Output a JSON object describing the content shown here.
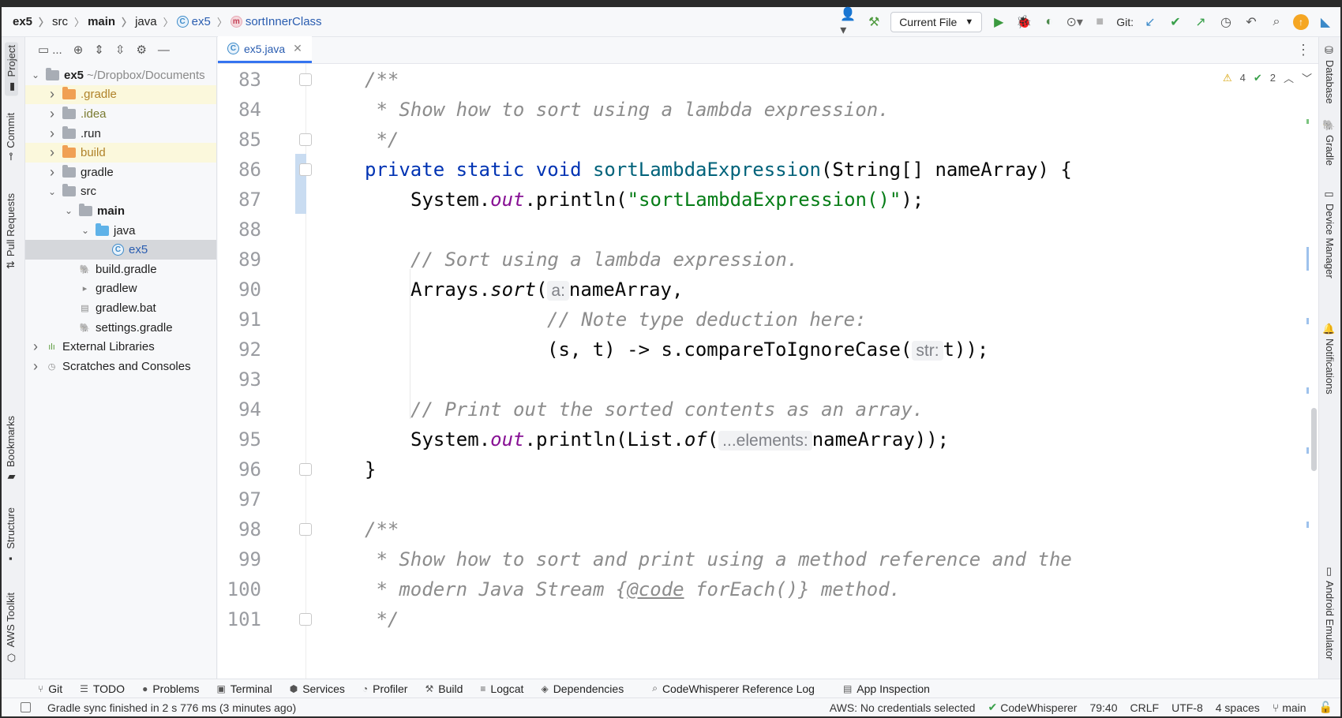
{
  "breadcrumbs": [
    {
      "label": "ex5",
      "bold": true
    },
    {
      "label": "src",
      "bold": false
    },
    {
      "label": "main",
      "bold": true
    },
    {
      "label": "java",
      "bold": false
    },
    {
      "label": "ex5",
      "bold": false,
      "icon": "class-icon"
    },
    {
      "label": "sortInnerClass",
      "bold": false,
      "icon": "method-icon"
    }
  ],
  "toolbar": {
    "run_config": "Current File",
    "git_label": "Git:"
  },
  "left_tabs": [
    "Project",
    "Commit",
    "Pull Requests",
    "Bookmarks",
    "Structure",
    "AWS Toolkit"
  ],
  "right_tabs": [
    "Database",
    "Gradle",
    "Device Manager",
    "Notifications",
    "Android Emulator"
  ],
  "project": {
    "toolbar_label": "...",
    "tree": [
      {
        "label": "ex5",
        "suffix": "~/Dropbox/Documents",
        "level": 0,
        "chevron": "down",
        "kind": "module",
        "bold": true
      },
      {
        "label": ".gradle",
        "level": 1,
        "chevron": "right",
        "kind": "folder-orange",
        "hl": true
      },
      {
        "label": ".idea",
        "level": 1,
        "chevron": "right",
        "kind": "folder-gray"
      },
      {
        "label": ".run",
        "level": 1,
        "chevron": "right",
        "kind": "folder-gray"
      },
      {
        "label": "build",
        "level": 1,
        "chevron": "right",
        "kind": "folder-orange",
        "hl": true
      },
      {
        "label": "gradle",
        "level": 1,
        "chevron": "right",
        "kind": "folder-gray"
      },
      {
        "label": "src",
        "level": 1,
        "chevron": "down",
        "kind": "folder-gray"
      },
      {
        "label": "main",
        "level": 2,
        "chevron": "down",
        "kind": "folder-gray",
        "bold": true
      },
      {
        "label": "java",
        "level": 3,
        "chevron": "down",
        "kind": "folder-blue"
      },
      {
        "label": "ex5",
        "level": 4,
        "chevron": "",
        "kind": "class",
        "sel": true
      },
      {
        "label": "build.gradle",
        "level": 2,
        "chevron": "",
        "kind": "gradle"
      },
      {
        "label": "gradlew",
        "level": 2,
        "chevron": "",
        "kind": "script"
      },
      {
        "label": "gradlew.bat",
        "level": 2,
        "chevron": "",
        "kind": "doc"
      },
      {
        "label": "settings.gradle",
        "level": 2,
        "chevron": "",
        "kind": "gradle"
      },
      {
        "label": "External Libraries",
        "level": 0,
        "chevron": "right",
        "kind": "libs"
      },
      {
        "label": "Scratches and Consoles",
        "level": 0,
        "chevron": "right",
        "kind": "scratch"
      }
    ]
  },
  "editor": {
    "tab_label": "ex5.java",
    "inspections": {
      "warnings": "4",
      "typos": "2"
    },
    "line_numbers": [
      "83",
      "84",
      "85",
      "86",
      "87",
      "88",
      "89",
      "90",
      "91",
      "92",
      "93",
      "94",
      "95",
      "96",
      "97",
      "98",
      "99",
      "100",
      "101"
    ],
    "code": {
      "l83": "/**",
      "l84": " * Show how to sort using a lambda expression.",
      "l85": " */",
      "l86_kw": "private static void ",
      "l86_fn": "sortLambdaExpression",
      "l86_rest": "(String[] nameArray) {",
      "l87_a": "System.",
      "l87_out": "out",
      "l87_b": ".println(",
      "l87_str": "\"sortLambdaExpression()\"",
      "l87_c": ");",
      "l89": "// Sort using a lambda expression.",
      "l90_a": "Arrays.",
      "l90_sort": "sort",
      "l90_b": "(",
      "l90_hint": "a:",
      "l90_c": "nameArray,",
      "l91": "// Note type deduction here:",
      "l92_a": "(s, t) -> s.compareToIgnoreCase(",
      "l92_hint": "str:",
      "l92_b": "t));",
      "l94": "// Print out the sorted contents as an array.",
      "l95_a": "System.",
      "l95_out": "out",
      "l95_b": ".println(List.",
      "l95_of": "of",
      "l95_c": "(",
      "l95_hint": "...elements:",
      "l95_d": "nameArray));",
      "l96": "}",
      "l98": "/**",
      "l99": " * Show how to sort and print using a method reference and the",
      "l100_a": " * modern Java Stream {",
      "l100_tag": "@code",
      "l100_b": " forEach()} method.",
      "l101": " */"
    }
  },
  "bottom_tools": [
    "Git",
    "TODO",
    "Problems",
    "Terminal",
    "Services",
    "Profiler",
    "Build",
    "Logcat",
    "Dependencies",
    "CodeWhisperer Reference Log",
    "App Inspection"
  ],
  "status": {
    "message": "Gradle sync finished in 2 s 776 ms (3 minutes ago)",
    "aws": "AWS: No credentials selected",
    "codewhisperer": "CodeWhisperer",
    "position": "79:40",
    "line_sep": "CRLF",
    "encoding": "UTF-8",
    "indent": "4 spaces",
    "branch": "main"
  },
  "colors": {
    "keyword": "#0033b3",
    "method": "#00627a",
    "string": "#067d17",
    "comment": "#8c8c8c",
    "static_field": "#871094",
    "accent": "#3574f0"
  }
}
